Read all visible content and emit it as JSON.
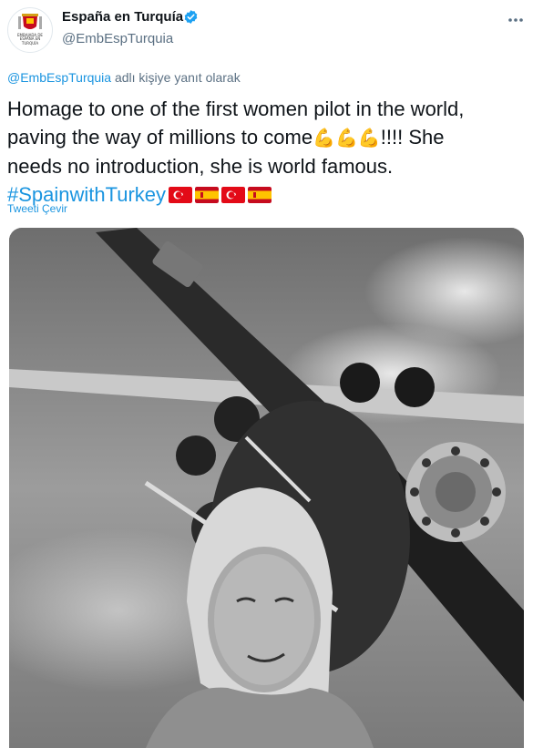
{
  "author": {
    "display_name": "España en Turquía",
    "handle": "@EmbEspTurquia",
    "verified": true,
    "avatar_text": "EMBAJADA DE ESPAÑA EN TURQUÍA"
  },
  "reply": {
    "mention": "@EmbEspTurquia",
    "suffix": " adlı kişiye yanıt olarak"
  },
  "tweet": {
    "text_line1": "Homage to one of the first women pilot in the world,",
    "text_line2_start": "paving the way of millions to come",
    "emojis": "💪💪💪",
    "text_line2_end": "!!!! She",
    "text_line3": "needs no introduction, she is world famous.",
    "hashtag": "#SpainwithTurkey",
    "flags": [
      "turkey-flag",
      "spain-flag",
      "turkey-flag",
      "spain-flag"
    ]
  },
  "translate_label": "Tweeti Çevir",
  "colors": {
    "link": "#1b95e0",
    "muted": "#5b7083",
    "verified": "#1da1f2",
    "turkey_red": "#e30a17",
    "spain_red": "#c60b1e",
    "spain_yellow": "#ffc400"
  },
  "icons": {
    "more": "more-icon",
    "verified": "verified-badge-icon"
  }
}
